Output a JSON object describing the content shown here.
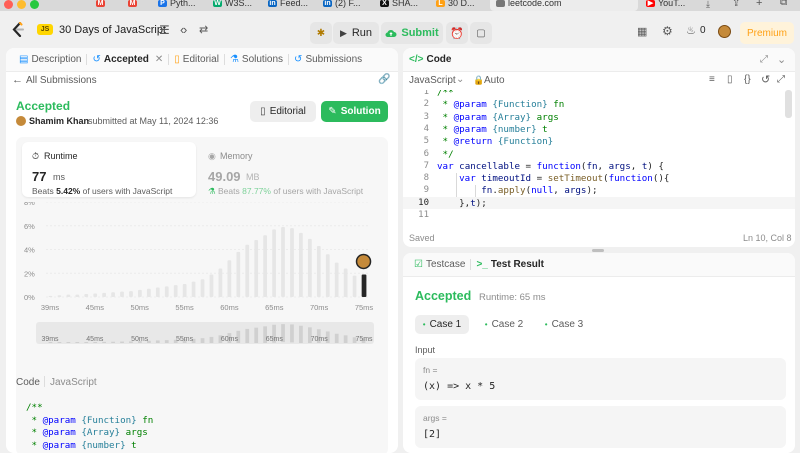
{
  "browser": {
    "tabs": [
      {
        "label": "",
        "color": "#ea4335",
        "icon": "M"
      },
      {
        "label": "",
        "color": "#ea4335",
        "icon": "M"
      },
      {
        "label": "Pyth...",
        "color": "#1a73e8",
        "icon": "P"
      },
      {
        "label": "W3S...",
        "color": "#04aa6d",
        "icon": "W"
      },
      {
        "label": "Feed...",
        "color": "#0a66c2",
        "icon": "in"
      },
      {
        "label": "(2) F...",
        "color": "#0a66c2",
        "icon": "in"
      },
      {
        "label": "SHA...",
        "color": "#111111",
        "icon": "X"
      },
      {
        "label": "30 D...",
        "color": "#ffa116",
        "icon": "L"
      },
      {
        "label": "leetcode.com",
        "color": "#777777",
        "icon": ""
      },
      {
        "label": "YouT...",
        "color": "#ff0000",
        "icon": "▶"
      }
    ]
  },
  "header": {
    "logo_badge": "JS",
    "title": "30 Days of JavaScript",
    "run_label": "Run",
    "submit_label": "Submit",
    "streak": "0",
    "premium_label": "Premium"
  },
  "left_tabs": {
    "description": "Description",
    "accepted": "Accepted",
    "editorial": "Editorial",
    "solutions": "Solutions",
    "submissions": "Submissions"
  },
  "submission": {
    "back_label": "All Submissions",
    "status": "Accepted",
    "user": "Shamim Khan",
    "submitted_text": "submitted at May 11, 2024 12:36",
    "editorial_btn": "Editorial",
    "solution_btn": "Solution",
    "runtime": {
      "label": "Runtime",
      "value": "77",
      "unit": "ms",
      "beats_prefix": "Beats",
      "beats_pct": "5.42%",
      "beats_suffix": "of users with JavaScript"
    },
    "memory": {
      "label": "Memory",
      "value": "49.09",
      "unit": "MB",
      "beats_prefix": "Beats",
      "beats_pct": "87.77%",
      "beats_suffix": "of users with JavaScript"
    }
  },
  "chart_data": {
    "type": "bar",
    "y_ticks": [
      "8%",
      "6%",
      "4%",
      "2%",
      "0%"
    ],
    "ylim": [
      0,
      8
    ],
    "x_ticks": [
      "39ms",
      "45ms",
      "50ms",
      "55ms",
      "60ms",
      "65ms",
      "70ms",
      "75ms"
    ],
    "values": [
      0.1,
      0.15,
      0.2,
      0.2,
      0.25,
      0.3,
      0.35,
      0.4,
      0.45,
      0.5,
      0.6,
      0.7,
      0.8,
      0.9,
      1.0,
      1.1,
      1.3,
      1.5,
      1.9,
      2.4,
      3.1,
      3.8,
      4.4,
      4.8,
      5.2,
      5.7,
      5.9,
      5.8,
      5.4,
      4.9,
      4.3,
      3.6,
      2.9,
      2.4,
      1.8,
      1.4
    ],
    "highlight_index": 35,
    "colors": {
      "bar": "#e6e6e6",
      "highlight": "#262626"
    }
  },
  "mini_chart": {
    "ticks": [
      "39ms",
      "45ms",
      "50ms",
      "55ms",
      "60ms",
      "65ms",
      "70ms",
      "75ms"
    ]
  },
  "left_code": {
    "label": "Code",
    "language": "JavaScript",
    "lines": [
      [
        {
          "t": "/**",
          "c": "cm"
        }
      ],
      [
        {
          "t": " * ",
          "c": "cm"
        },
        {
          "t": "@param",
          "c": "kw"
        },
        {
          "t": " ",
          "c": "cm"
        },
        {
          "t": "{Function}",
          "c": "tp"
        },
        {
          "t": " fn",
          "c": "cm"
        }
      ],
      [
        {
          "t": " * ",
          "c": "cm"
        },
        {
          "t": "@param",
          "c": "kw"
        },
        {
          "t": " ",
          "c": "cm"
        },
        {
          "t": "{Array}",
          "c": "tp"
        },
        {
          "t": " args",
          "c": "cm"
        }
      ],
      [
        {
          "t": " * ",
          "c": "cm"
        },
        {
          "t": "@param",
          "c": "kw"
        },
        {
          "t": " ",
          "c": "cm"
        },
        {
          "t": "{number}",
          "c": "tp"
        },
        {
          "t": " t",
          "c": "cm"
        }
      ]
    ]
  },
  "code_panel": {
    "title": "Code",
    "language": "JavaScript",
    "auto_label": "Auto",
    "saved_label": "Saved",
    "cursor": "Ln 10, Col 8",
    "line_numbers": [
      "1",
      "2",
      "3",
      "4",
      "5",
      "6",
      "7",
      "8",
      "9",
      "10",
      "11"
    ],
    "lines": [
      [
        {
          "t": "/**",
          "c": "cm"
        }
      ],
      [
        {
          "t": " * ",
          "c": "cm"
        },
        {
          "t": "@param",
          "c": "kw"
        },
        {
          "t": " ",
          "c": "cm"
        },
        {
          "t": "{Function}",
          "c": "tp"
        },
        {
          "t": " fn",
          "c": "cm"
        }
      ],
      [
        {
          "t": " * ",
          "c": "cm"
        },
        {
          "t": "@param",
          "c": "kw"
        },
        {
          "t": " ",
          "c": "cm"
        },
        {
          "t": "{Array}",
          "c": "tp"
        },
        {
          "t": " args",
          "c": "cm"
        }
      ],
      [
        {
          "t": " * ",
          "c": "cm"
        },
        {
          "t": "@param",
          "c": "kw"
        },
        {
          "t": " ",
          "c": "cm"
        },
        {
          "t": "{number}",
          "c": "tp"
        },
        {
          "t": " t",
          "c": "cm"
        }
      ],
      [
        {
          "t": " * ",
          "c": "cm"
        },
        {
          "t": "@return",
          "c": "kw"
        },
        {
          "t": " ",
          "c": "cm"
        },
        {
          "t": "{Function}",
          "c": "tp"
        }
      ],
      [
        {
          "t": " */",
          "c": "cm"
        }
      ],
      [
        {
          "t": "var",
          "c": "kw"
        },
        {
          "t": " ",
          "c": ""
        },
        {
          "t": "cancellable",
          "c": "vr"
        },
        {
          "t": " = ",
          "c": ""
        },
        {
          "t": "function",
          "c": "kw"
        },
        {
          "t": "(",
          "c": ""
        },
        {
          "t": "fn",
          "c": "vr"
        },
        {
          "t": ", ",
          "c": ""
        },
        {
          "t": "args",
          "c": "vr"
        },
        {
          "t": ", ",
          "c": ""
        },
        {
          "t": "t",
          "c": "vr"
        },
        {
          "t": ") {",
          "c": ""
        }
      ],
      [
        {
          "t": "    ",
          "c": ""
        },
        {
          "t": "var",
          "c": "kw"
        },
        {
          "t": " ",
          "c": ""
        },
        {
          "t": "timeoutId",
          "c": "vr"
        },
        {
          "t": " = ",
          "c": ""
        },
        {
          "t": "setTimeout",
          "c": "fn"
        },
        {
          "t": "(",
          "c": ""
        },
        {
          "t": "function",
          "c": "kw"
        },
        {
          "t": "(){",
          "c": ""
        }
      ],
      [
        {
          "t": "        ",
          "c": ""
        },
        {
          "t": "fn",
          "c": "vr"
        },
        {
          "t": ".",
          "c": ""
        },
        {
          "t": "apply",
          "c": "fn"
        },
        {
          "t": "(",
          "c": ""
        },
        {
          "t": "null",
          "c": "kw"
        },
        {
          "t": ", ",
          "c": ""
        },
        {
          "t": "args",
          "c": "vr"
        },
        {
          "t": ");",
          "c": ""
        }
      ],
      [
        {
          "t": "    },",
          "c": ""
        },
        {
          "t": "t",
          "c": "vr"
        },
        {
          "t": ");",
          "c": ""
        }
      ],
      [
        {
          "t": "",
          "c": ""
        }
      ]
    ]
  },
  "test_panel": {
    "testcase_tab": "Testcase",
    "result_tab": "Test Result",
    "status": "Accepted",
    "runtime_text": "Runtime: 65 ms",
    "cases": [
      "Case 1",
      "Case 2",
      "Case 3"
    ],
    "input_label": "Input",
    "params": [
      {
        "name": "fn =",
        "value": "(x) => x * 5"
      },
      {
        "name": "args =",
        "value": "[2]"
      }
    ]
  },
  "colors": {
    "accent_green": "#2cbb5d",
    "orange": "#ffa116",
    "premium_bg": "#fff3da"
  }
}
